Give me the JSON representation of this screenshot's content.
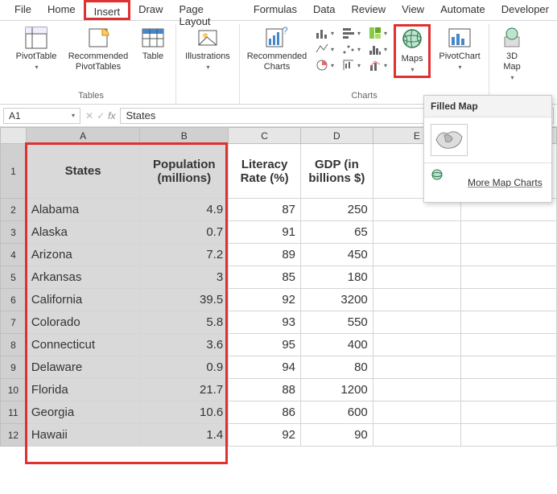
{
  "menu": {
    "items": [
      "File",
      "Home",
      "Insert",
      "Draw",
      "Page Layout",
      "Formulas",
      "Data",
      "Review",
      "View",
      "Automate",
      "Developer"
    ],
    "active": "Insert"
  },
  "ribbon": {
    "tables_label": "Tables",
    "pivot_table": "PivotTable",
    "rec_pivot": "Recommended\nPivotTables",
    "table": "Table",
    "illustrations": "Illustrations",
    "rec_charts": "Recommended\nCharts",
    "charts_label": "Charts",
    "maps": "Maps",
    "pivot_chart": "PivotChart",
    "map_3d": "3D\nMap"
  },
  "namebox": "A1",
  "formula": "States",
  "columns": [
    "A",
    "B",
    "C",
    "D",
    "E"
  ],
  "headers": {
    "A": "States",
    "B": "Population (millions)",
    "C": "Literacy Rate (%)",
    "D": "GDP (in billions $)"
  },
  "rows": [
    {
      "n": 2,
      "A": "Alabama",
      "B": "4.9",
      "C": "87",
      "D": "250"
    },
    {
      "n": 3,
      "A": "Alaska",
      "B": "0.7",
      "C": "91",
      "D": "65"
    },
    {
      "n": 4,
      "A": "Arizona",
      "B": "7.2",
      "C": "89",
      "D": "450"
    },
    {
      "n": 5,
      "A": "Arkansas",
      "B": "3",
      "C": "85",
      "D": "180"
    },
    {
      "n": 6,
      "A": "California",
      "B": "39.5",
      "C": "92",
      "D": "3200"
    },
    {
      "n": 7,
      "A": "Colorado",
      "B": "5.8",
      "C": "93",
      "D": "550"
    },
    {
      "n": 8,
      "A": "Connecticut",
      "B": "3.6",
      "C": "95",
      "D": "400"
    },
    {
      "n": 9,
      "A": "Delaware",
      "B": "0.9",
      "C": "94",
      "D": "80"
    },
    {
      "n": 10,
      "A": "Florida",
      "B": "21.7",
      "C": "88",
      "D": "1200"
    },
    {
      "n": 11,
      "A": "Georgia",
      "B": "10.6",
      "C": "86",
      "D": "600"
    },
    {
      "n": 12,
      "A": "Hawaii",
      "B": "1.4",
      "C": "92",
      "D": "90"
    }
  ],
  "maps_popup": {
    "title": "Filled Map",
    "more": "More Map Charts"
  }
}
